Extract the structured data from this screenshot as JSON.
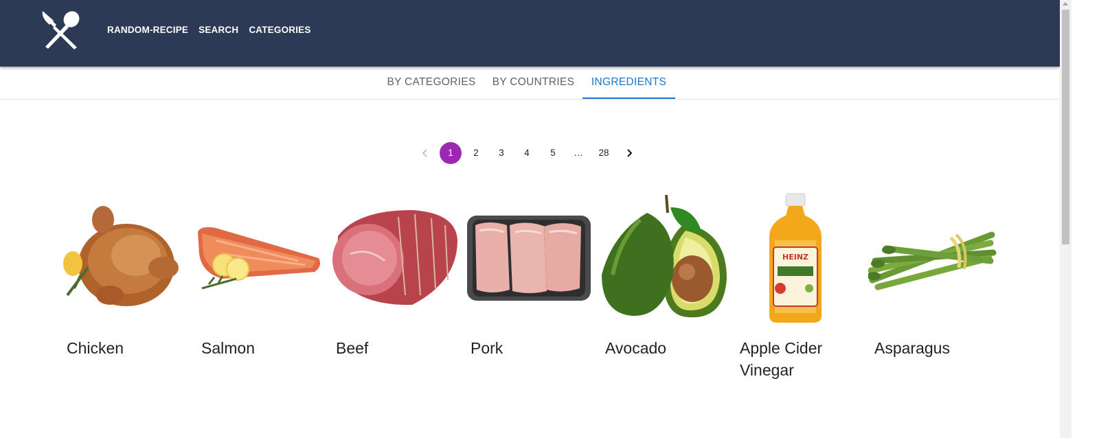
{
  "nav": {
    "logo_icon": "fork-spoon-icon",
    "links": [
      "RANDOM-RECIPE",
      "SEARCH",
      "CATEGORIES"
    ]
  },
  "tabs": [
    {
      "label": "BY CATEGORIES",
      "active": false
    },
    {
      "label": "BY COUNTRIES",
      "active": false
    },
    {
      "label": "INGREDIENTS",
      "active": true
    }
  ],
  "pagination": {
    "pages": [
      "1",
      "2",
      "3",
      "4",
      "5",
      "…",
      "28"
    ],
    "current": "1",
    "prev_icon": "chevron-left-icon",
    "next_icon": "chevron-right-icon"
  },
  "ingredients": [
    {
      "name": "Chicken",
      "icon": "chicken-image"
    },
    {
      "name": "Salmon",
      "icon": "salmon-image"
    },
    {
      "name": "Beef",
      "icon": "beef-image"
    },
    {
      "name": "Pork",
      "icon": "pork-image"
    },
    {
      "name": "Avocado",
      "icon": "avocado-image"
    },
    {
      "name": "Apple Cider Vinegar",
      "icon": "vinegar-bottle-image",
      "label_text": "HEINZ"
    },
    {
      "name": "Asparagus",
      "icon": "asparagus-image"
    }
  ],
  "colors": {
    "appbar": "#2d3a55",
    "tab_active": "#1976d2",
    "page_active": "#9c27b0"
  }
}
